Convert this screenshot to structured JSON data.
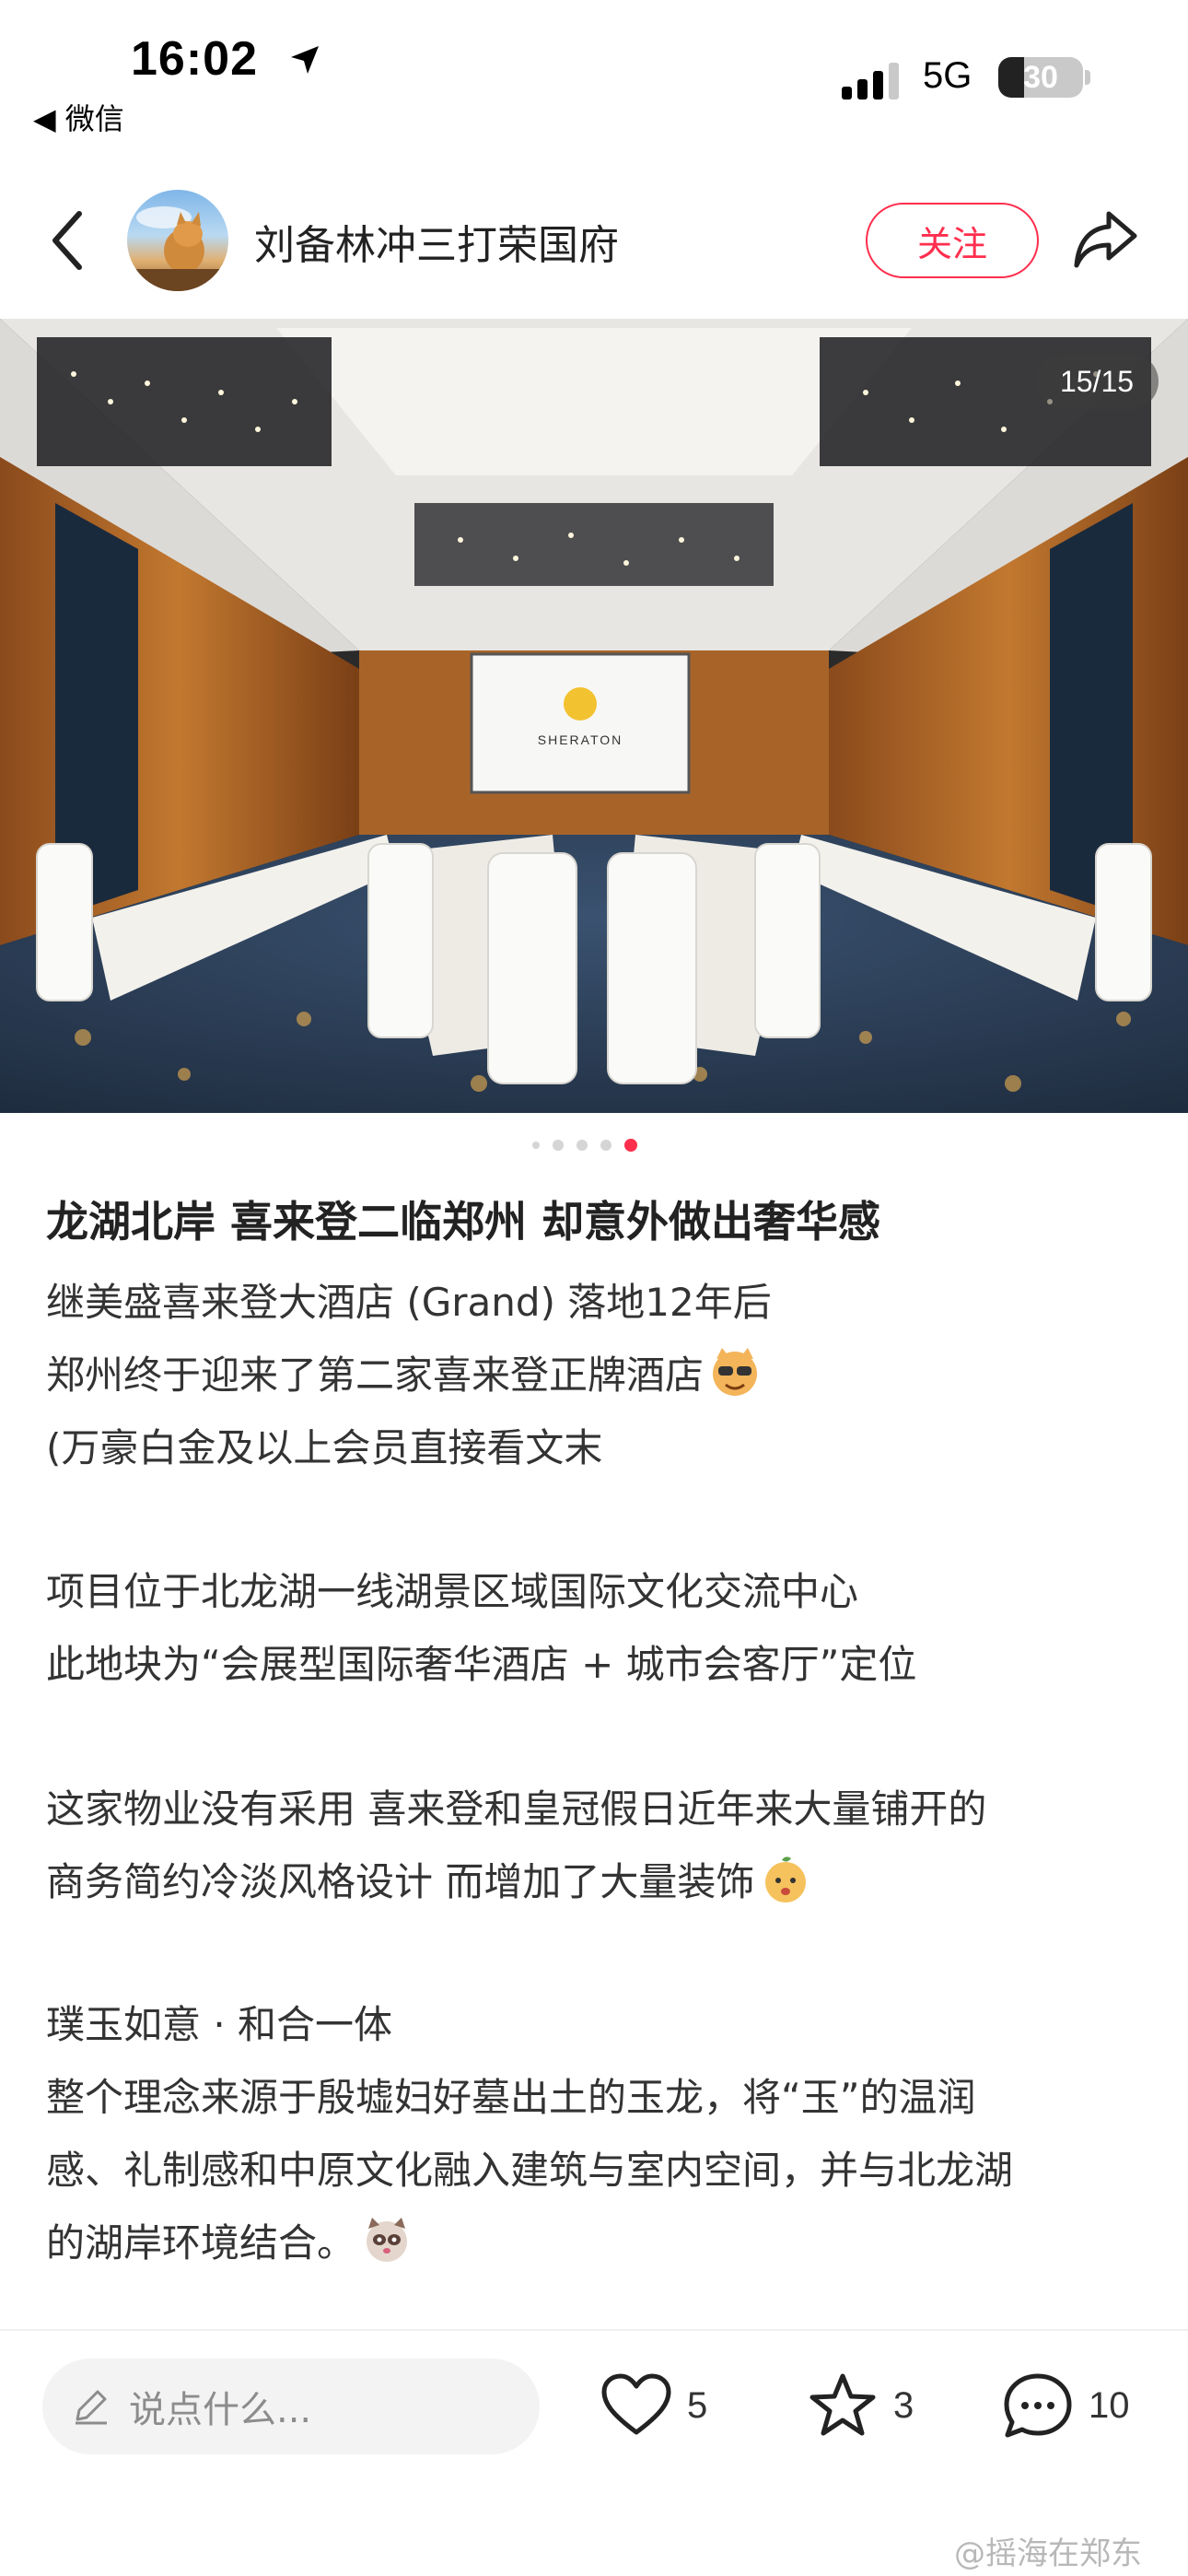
{
  "status_bar": {
    "time": "16:02",
    "back_app": "◀ 微信",
    "network": "5G",
    "battery": "30",
    "battery_level": 0.3
  },
  "header": {
    "username": "刘备林冲三打荣国府",
    "follow_label": "关注"
  },
  "photo": {
    "counter": "15/15",
    "screen_logo": "SHERATON",
    "dots_total": 5,
    "dots_active": 5
  },
  "post": {
    "title": "龙湖北岸 喜来登二临郑州 却意外做出奢华感",
    "lines": [
      "继美盛喜来登大酒店 (Grand) 落地12年后",
      "郑州终于迎来了第二家喜来登正牌酒店",
      "(万豪白金及以上会员直接看文末",
      "项目位于北龙湖一线湖景区域国际文化交流中心",
      "此地块为“会展型国际奢华酒店 + 城市会客厅”定位",
      "这家物业没有采用 喜来登和皇冠假日近年来大量铺开的",
      "商务简约冷淡风格设计 而增加了大量装饰",
      "璞玉如意 · 和合一体",
      "整个理念来源于殷墟妇好墓出土的玉龙，将“玉”的温润",
      "感、礼制感和中原文化融入建筑与室内空间，并与北龙湖",
      "的湖岸环境结合。"
    ]
  },
  "bottom_bar": {
    "comment_placeholder": "说点什么...",
    "likes": "5",
    "stars": "3",
    "comments": "10"
  },
  "watermark": "@摇海在郑东",
  "colors": {
    "accent": "#ff2e4d",
    "text": "#222222",
    "muted": "#8c8c8c"
  }
}
